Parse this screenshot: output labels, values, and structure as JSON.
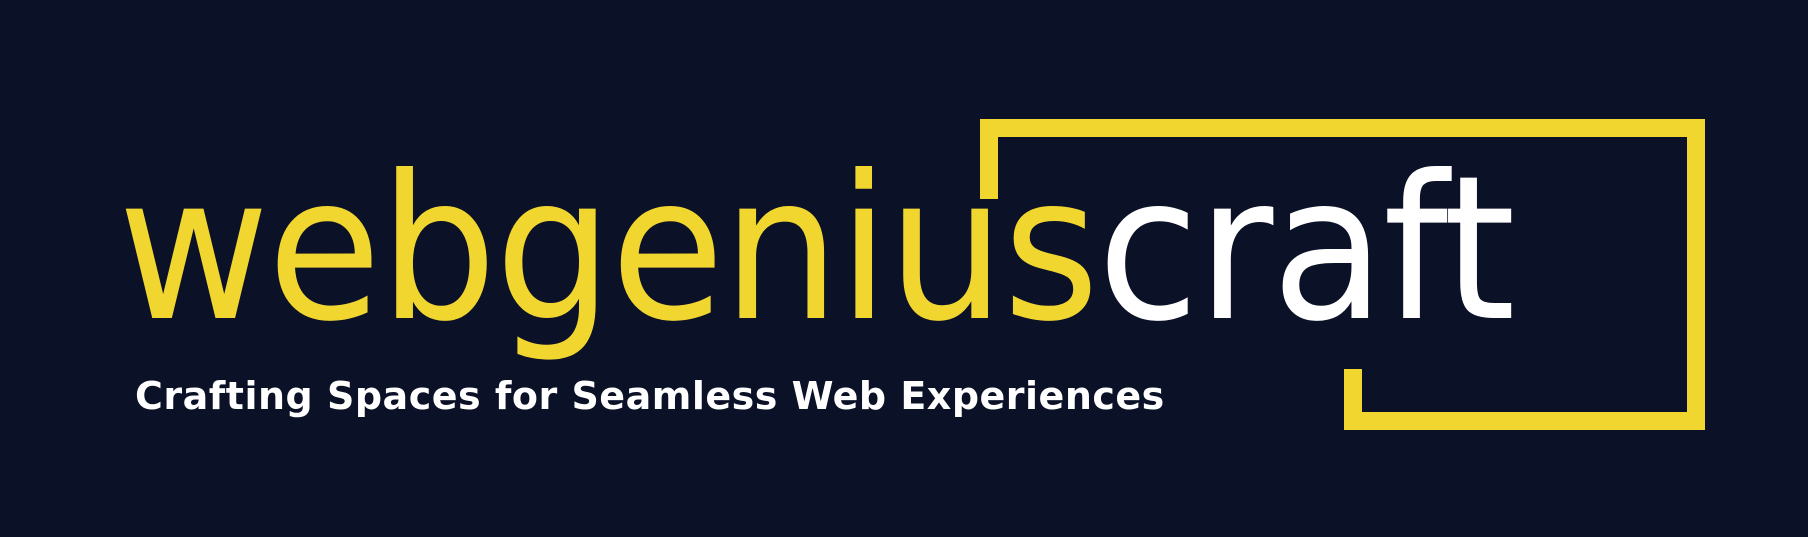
{
  "brand": {
    "name_part_1": "webgenius",
    "name_part_2": "craft",
    "tagline": "Crafting Spaces for Seamless Web Experiences"
  },
  "colors": {
    "background": "#0b1127",
    "accent_yellow": "#f2d630",
    "text_white": "#ffffff"
  },
  "icons": {
    "frame": "bracket-frame-icon"
  }
}
